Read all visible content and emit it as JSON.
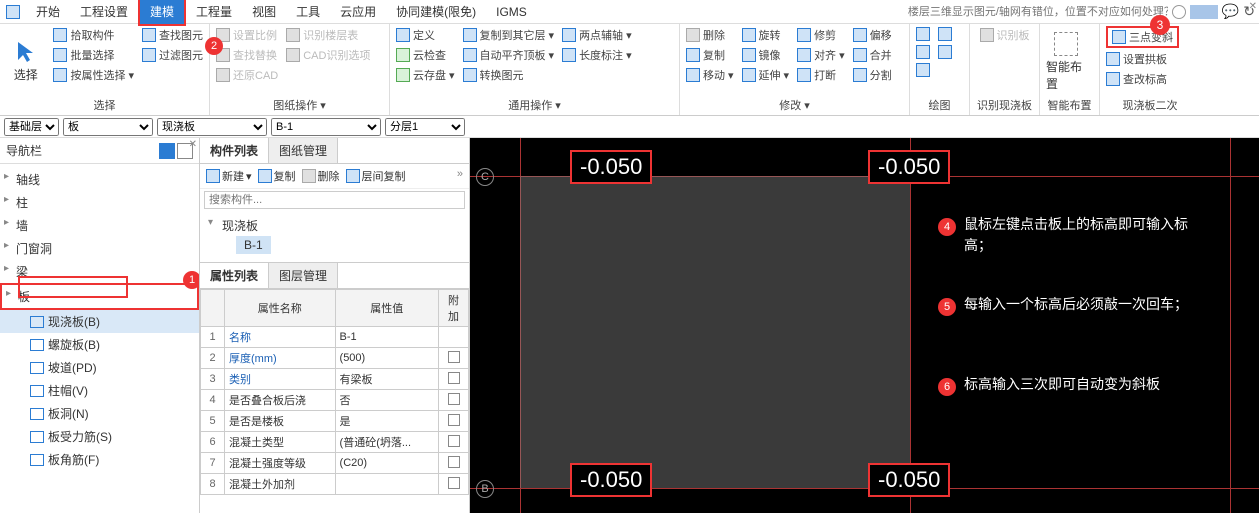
{
  "tabs": [
    "开始",
    "工程设置",
    "建模",
    "工程量",
    "视图",
    "工具",
    "云应用",
    "协同建模(限免)",
    "IGMS"
  ],
  "active_tab_index": 2,
  "search_placeholder": "楼层三维显示图元/轴网有错位，位置不对应如何处理？",
  "ribbon": {
    "select": {
      "big": "选择",
      "items": [
        "拾取构件",
        "批量选择",
        "按属性选择"
      ],
      "label": "选择"
    },
    "find": {
      "items": [
        "查找图元",
        "过滤图元"
      ]
    },
    "g_dis1": [
      "设置比例",
      "查找替换",
      "还原CAD"
    ],
    "g_dis2": [
      "识别楼层表",
      "CAD识别选项"
    ],
    "g_label1": "图纸操作",
    "g2c1": [
      "定义",
      "云检查",
      "自动平齐顶板",
      "云存盘"
    ],
    "g2c2": [
      "复制到其它层",
      "两点辅轴",
      "长度标注",
      "转换图元"
    ],
    "g_label2": "通用操作",
    "g3c1": [
      "删除",
      "复制",
      "移动"
    ],
    "g3c2": [
      "旋转",
      "镜像",
      "延伸"
    ],
    "g3c3": [
      "修剪",
      "对齐",
      "打断"
    ],
    "g3c4": [
      "偏移",
      "合并",
      "分割"
    ],
    "g_label3": "修改",
    "g_label4": "绘图",
    "idf": "识别板",
    "g_label5": "识别现浇板",
    "smart": "智能布置",
    "g_label6": "智能布置",
    "rc1": [
      "三点变斜",
      "设置拱板",
      "查改标高"
    ],
    "g_label7": "现浇板二次"
  },
  "dropdowns": {
    "floor": "基础层",
    "type": "板",
    "sub": "现浇板",
    "name": "B-1",
    "layer": "分层1"
  },
  "nav": {
    "title": "导航栏",
    "tree": [
      "轴线",
      "柱",
      "墙",
      "门窗洞",
      "梁"
    ],
    "board_label": "板",
    "sub": [
      {
        "label": "现浇板(B)"
      },
      {
        "label": "螺旋板(B)"
      },
      {
        "label": "坡道(PD)"
      },
      {
        "label": "柱帽(V)"
      },
      {
        "label": "板洞(N)"
      },
      {
        "label": "板受力筋(S)"
      },
      {
        "label": "板角筋(F)"
      }
    ]
  },
  "mid": {
    "tabs": [
      "构件列表",
      "图纸管理"
    ],
    "toolbar": [
      "新建",
      "复制",
      "删除",
      "层间复制"
    ],
    "search_ph": "搜索构件...",
    "tree_root": "现浇板",
    "tree_leaf": "B-1",
    "prop_tabs": [
      "属性列表",
      "图层管理"
    ],
    "cols": [
      "属性名称",
      "属性值",
      "附加"
    ],
    "rows": [
      {
        "n": "1",
        "name": "名称",
        "val": "B-1",
        "link": true
      },
      {
        "n": "2",
        "name": "厚度(mm)",
        "val": "(500)",
        "link": true
      },
      {
        "n": "3",
        "name": "类别",
        "val": "有梁板",
        "link": true
      },
      {
        "n": "4",
        "name": "是否叠合板后浇",
        "val": "否"
      },
      {
        "n": "5",
        "name": "是否是楼板",
        "val": "是"
      },
      {
        "n": "6",
        "name": "混凝土类型",
        "val": "(普通砼(坍落..."
      },
      {
        "n": "7",
        "name": "混凝土强度等级",
        "val": "(C20)"
      },
      {
        "n": "8",
        "name": "混凝土外加剂",
        "val": ""
      }
    ]
  },
  "canvas": {
    "axis_c": "C",
    "axis_b": "B",
    "elev": "-0.050",
    "notes": [
      "鼠标左键点击板上的标高即可输入标高；",
      "每输入一个标高后必须敲一次回车；",
      "标高输入三次即可自动变为斜板"
    ]
  },
  "markers": {
    "m1": "1",
    "m2": "2",
    "m3": "3",
    "m4": "4",
    "m5": "5",
    "m6": "6"
  }
}
